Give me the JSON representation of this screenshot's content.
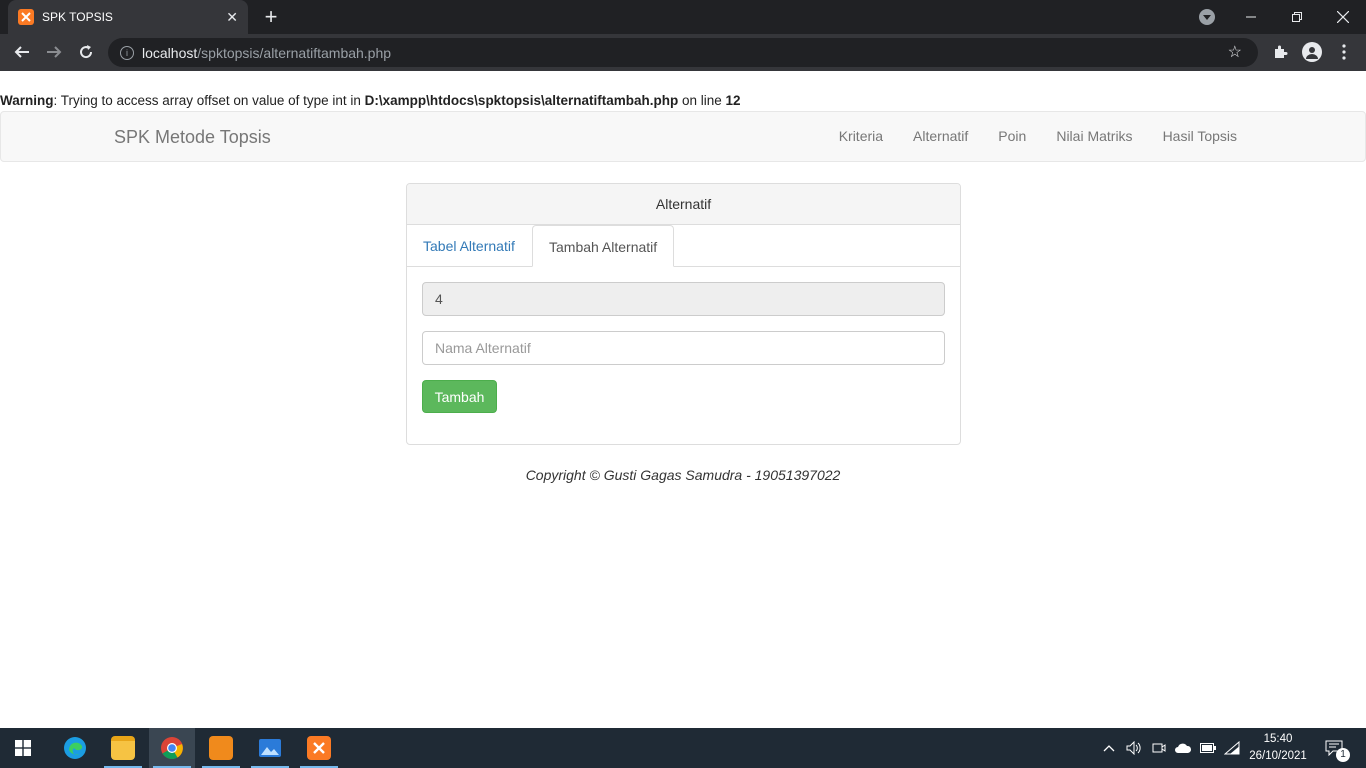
{
  "browser": {
    "tab_title": "SPK TOPSIS",
    "close_glyph": "✕",
    "new_tab_glyph": "+",
    "url_host": "localhost",
    "url_path": "/spktopsis/alternatiftambah.php"
  },
  "warning": {
    "label": "Warning",
    "message": ": Trying to access array offset on value of type int in ",
    "path": "D:\\xampp\\htdocs\\spktopsis\\alternatiftambah.php",
    "line_text": " on line ",
    "line_number": "12"
  },
  "navbar": {
    "brand": "SPK Metode Topsis",
    "links": [
      "Kriteria",
      "Alternatif",
      "Poin",
      "Nilai Matriks",
      "Hasil Topsis"
    ]
  },
  "panel": {
    "heading": "Alternatif",
    "tabs": [
      "Tabel Alternatif",
      "Tambah Alternatif"
    ],
    "id_value": "4",
    "name_placeholder": "Nama Alternatif",
    "submit_label": "Tambah"
  },
  "footer": {
    "copyright": "Copyright © Gusti Gagas Samudra - 19051397022"
  },
  "taskbar": {
    "time": "15:40",
    "date": "26/10/2021",
    "notification_count": "1"
  },
  "colors": {
    "success": "#5cb85c",
    "link": "#337ab7",
    "taskbar": "#1f2a35"
  }
}
